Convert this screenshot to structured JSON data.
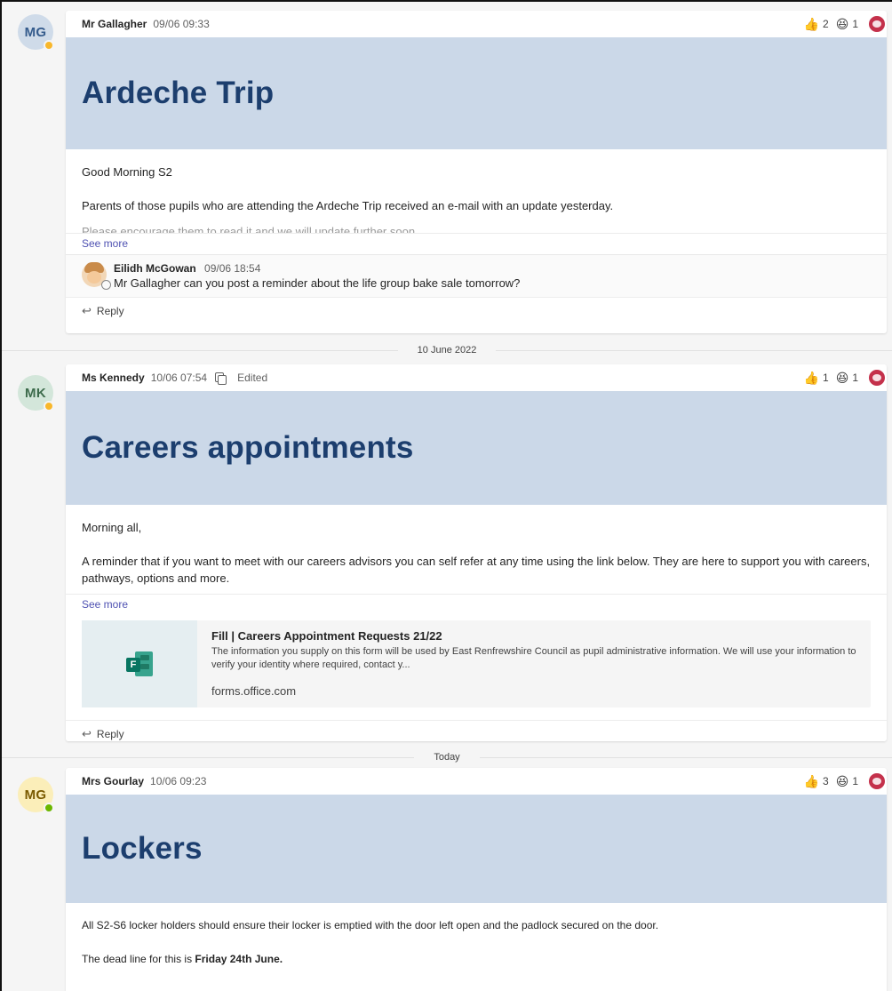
{
  "posts": [
    {
      "initials": "MG",
      "author": "Mr Gallagher",
      "time": "09/06 09:33",
      "edited": "",
      "reactions": [
        {
          "icon": "like-emoji",
          "count": "2"
        },
        {
          "icon": "laugh-emoji",
          "count": "1"
        }
      ],
      "title": "Ardeche Trip",
      "paragraphs": [
        "Good Morning S2",
        "Parents of those pupils who are attending the Ardeche Trip received an e-mail with an update yesterday."
      ],
      "truncated_line": "Please encourage them to read it and we will update further soon.",
      "see_more": "See more",
      "reply": {
        "author": "Eilidh McGowan",
        "time": "09/06 18:54",
        "message": "Mr Gallagher can you post a reminder about the life group bake sale tomorrow?"
      },
      "reply_label": "Reply"
    },
    {
      "initials": "MK",
      "author": "Ms Kennedy",
      "time": "10/06 07:54",
      "edited": "Edited",
      "reactions": [
        {
          "icon": "like-emoji",
          "count": "1"
        },
        {
          "icon": "laugh-emoji",
          "count": "1"
        }
      ],
      "title": "Careers appointments",
      "paragraphs": [
        "Morning all,",
        "A reminder that if you want to meet with our careers advisors you can self refer at any time using the link below.  They are here to support you with careers, pathways, options and more."
      ],
      "see_more": "See more",
      "link_card": {
        "title": "Fill | Careers Appointment Requests 21/22",
        "description": "The information you supply on this form will be used by East Renfrewshire Council as pupil administrative information. We will use your information to verify your identity where required, contact y...",
        "domain": "forms.office.com",
        "icon_letter": "F"
      },
      "reply_label": "Reply"
    },
    {
      "initials": "MG",
      "author": "Mrs Gourlay",
      "time": "10/06 09:23",
      "reactions": [
        {
          "icon": "like-emoji",
          "count": "3"
        },
        {
          "icon": "laugh-emoji",
          "count": "1"
        }
      ],
      "title": "Lockers",
      "paragraphs": [
        "All S2-S6 locker holders should ensure their locker is emptied with the door left open and the padlock secured on the door."
      ],
      "deadline_prefix": "The dead line for this is ",
      "deadline_bold": "Friday 24th June."
    }
  ],
  "dividers": {
    "first": "10 June 2022",
    "second": "Today"
  },
  "colors": {
    "banner": "#cbd8e8",
    "title": "#1c3e6e",
    "link": "#4f52b2",
    "away": "#f8b72b",
    "online": "#6bb700"
  }
}
